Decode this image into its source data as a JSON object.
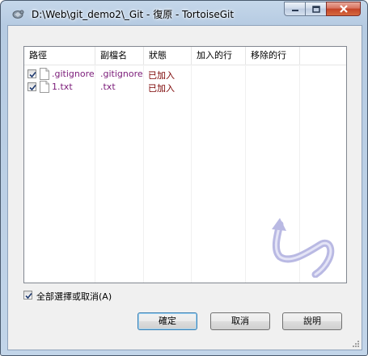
{
  "window": {
    "title": "D:\\Web\\git_demo2\\_Git - 復原 - TortoiseGit"
  },
  "list": {
    "columns": [
      "路徑",
      "副檔名",
      "狀態",
      "加入的行",
      "移除的行"
    ],
    "rows": [
      {
        "checked": true,
        "path": ".gitignore",
        "ext": ".gitignore",
        "status": "已加入"
      },
      {
        "checked": true,
        "path": "1.txt",
        "ext": ".txt",
        "status": "已加入"
      }
    ]
  },
  "select_all": {
    "checked": true,
    "label": "全部選擇或取消(A)"
  },
  "buttons": {
    "ok": "確定",
    "cancel": "取消",
    "help": "說明"
  },
  "icons": {
    "app": "tortoisegit-icon",
    "file": "file-icon",
    "watermark": "revert-arrow-watermark-icon"
  }
}
